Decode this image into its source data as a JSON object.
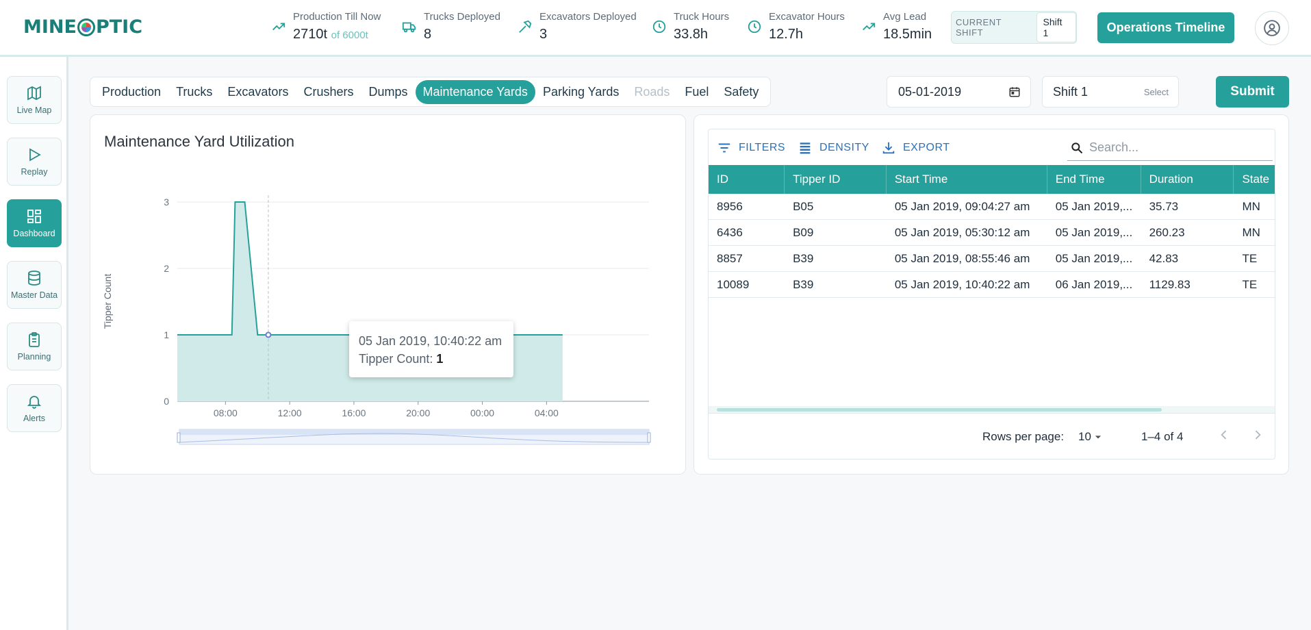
{
  "app": {
    "logo_left": "MINE",
    "logo_right": "PTIC"
  },
  "header": {
    "stats": [
      {
        "label": "Production Till Now",
        "value": "2710t",
        "suffix": "of 6000t",
        "icon": "trending-up-icon"
      },
      {
        "label": "Trucks Deployed",
        "value": "8",
        "suffix": "",
        "icon": "truck-icon"
      },
      {
        "label": "Excavators Deployed",
        "value": "3",
        "suffix": "",
        "icon": "hammer-icon"
      },
      {
        "label": "Truck Hours",
        "value": "33.8h",
        "suffix": "",
        "icon": "clock-icon"
      },
      {
        "label": "Excavator Hours",
        "value": "12.7h",
        "suffix": "",
        "icon": "clock-icon"
      },
      {
        "label": "Avg Lead",
        "value": "18.5min",
        "suffix": "",
        "icon": "trending-up-icon"
      }
    ],
    "current_shift_label": "CURRENT SHIFT",
    "current_shift_value": "Shift 1",
    "ops_button": "Operations Timeline"
  },
  "sidebar": {
    "items": [
      {
        "label": "Live Map",
        "icon": "map-icon"
      },
      {
        "label": "Replay",
        "icon": "play-icon"
      },
      {
        "label": "Dashboard",
        "icon": "dashboard-icon",
        "active": true
      },
      {
        "label": "Master Data",
        "icon": "database-icon"
      },
      {
        "label": "Planning",
        "icon": "clipboard-icon"
      },
      {
        "label": "Alerts",
        "icon": "bell-icon"
      }
    ]
  },
  "tabs": [
    "Production",
    "Trucks",
    "Excavators",
    "Crushers",
    "Dumps",
    "Maintenance Yards",
    "Parking Yards",
    "Roads",
    "Fuel",
    "Safety"
  ],
  "active_tab": "Maintenance Yards",
  "disabled_tab": "Roads",
  "filters": {
    "date": "05-01-2019",
    "shift": "Shift 1",
    "shift_hint": "Select",
    "submit": "Submit"
  },
  "chart_data": {
    "type": "area",
    "title": "Maintenance Yard Utilization",
    "ylabel": "Tipper Count",
    "xlabel": "",
    "ylim": [
      0,
      3
    ],
    "yticks": [
      0,
      1,
      2,
      3
    ],
    "xticks": [
      "08:00",
      "12:00",
      "16:00",
      "20:00",
      "00:00",
      "04:00"
    ],
    "x_hours_since_0500": [
      0,
      3.4,
      3.5,
      3.6,
      4.2,
      5.0,
      5.67,
      24
    ],
    "y": [
      1,
      1,
      2,
      3,
      3,
      1,
      1,
      1
    ],
    "tooltip": {
      "time": "05 Jan 2019, 10:40:22 am",
      "label": "Tipper Count:",
      "value": "1"
    },
    "colors": {
      "line": "#26a09a",
      "fill": "#cfeae8",
      "marker": "#6b7cc9"
    }
  },
  "table": {
    "toolbar": {
      "filters": "FILTERS",
      "density": "DENSITY",
      "export": "EXPORT"
    },
    "search_placeholder": "Search...",
    "columns": [
      "ID",
      "Tipper ID",
      "Start Time",
      "End Time",
      "Duration",
      "State"
    ],
    "rows": [
      [
        "8956",
        "B05",
        "05 Jan 2019, 09:04:27 am",
        "05 Jan 2019,...",
        "35.73",
        "MN"
      ],
      [
        "6436",
        "B09",
        "05 Jan 2019, 05:30:12 am",
        "05 Jan 2019,...",
        "260.23",
        "MN"
      ],
      [
        "8857",
        "B39",
        "05 Jan 2019, 08:55:46 am",
        "05 Jan 2019,...",
        "42.83",
        "TE"
      ],
      [
        "10089",
        "B39",
        "05 Jan 2019, 10:40:22 am",
        "06 Jan 2019,...",
        "1129.83",
        "TE"
      ]
    ],
    "footer": {
      "rows_per_page_label": "Rows per page:",
      "rows_per_page": "10",
      "range": "1–4 of 4"
    }
  }
}
